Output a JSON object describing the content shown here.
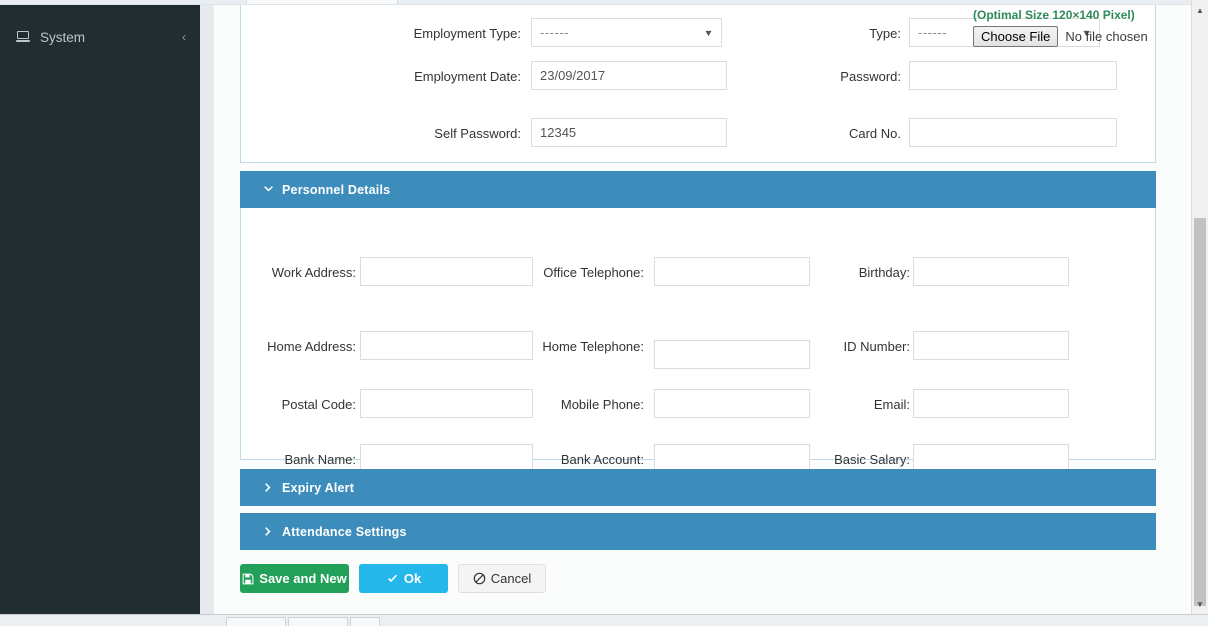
{
  "sidebar": {
    "item": {
      "label": "System",
      "icon": "monitor-icon",
      "collapse_icon": "chevron-left-icon"
    }
  },
  "employment_section": {
    "fields": [
      {
        "label": "Employment Type:",
        "type": "select",
        "value": "------",
        "name": "employment-type"
      },
      {
        "label": "Type:",
        "type": "select",
        "value": "------",
        "name": "type"
      },
      {
        "label": "Employment Date:",
        "type": "text",
        "value": "23/09/2017",
        "name": "employment-date"
      },
      {
        "label": "Password:",
        "type": "text",
        "value": "",
        "name": "password"
      },
      {
        "label": "Self Password:",
        "type": "text",
        "value": "12345",
        "name": "self-password"
      },
      {
        "label": "Card No.",
        "type": "text",
        "value": "",
        "name": "card-no"
      }
    ],
    "upload": {
      "hint": "(Optimal Size 120×140 Pixel)",
      "button_label": "Choose File",
      "status": "No file chosen"
    }
  },
  "personnel_section": {
    "title": "Personnel Details",
    "expanded": true,
    "toggle_icon": "chevron-down-icon",
    "fields": [
      {
        "label": "Work Address:",
        "value": "",
        "name": "work-address"
      },
      {
        "label": "Office Telephone:",
        "value": "",
        "name": "office-telephone"
      },
      {
        "label": "Birthday:",
        "value": "",
        "name": "birthday"
      },
      {
        "label": "Home Address:",
        "value": "",
        "name": "home-address"
      },
      {
        "label": "Home Telephone:",
        "value": "",
        "name": "home-telephone"
      },
      {
        "label": "ID Number:",
        "value": "",
        "name": "id-number"
      },
      {
        "label": "Postal Code:",
        "value": "",
        "name": "postal-code"
      },
      {
        "label": "Mobile Phone:",
        "value": "",
        "name": "mobile-phone"
      },
      {
        "label": "Email:",
        "value": "",
        "name": "email"
      },
      {
        "label": "Bank Name:",
        "value": "",
        "name": "bank-name"
      },
      {
        "label": "Bank Account:",
        "value": "",
        "name": "bank-account"
      },
      {
        "label": "Basic Salary:",
        "value": "",
        "name": "basic-salary"
      }
    ]
  },
  "expiry_section": {
    "title": "Expiry Alert",
    "expanded": false,
    "toggle_icon": "chevron-right-icon"
  },
  "attendance_section": {
    "title": "Attendance Settings",
    "expanded": false,
    "toggle_icon": "chevron-right-icon"
  },
  "footer": {
    "save_and_new": {
      "label": "Save and New",
      "icon": "floppy-disk-icon"
    },
    "ok": {
      "label": "Ok",
      "icon": "check-icon"
    },
    "cancel": {
      "label": "Cancel",
      "icon": "ban-icon"
    }
  },
  "colors": {
    "section_header_blue": "#3c8dbc",
    "sidebar_dark": "#222d32",
    "save_green": "#22a05a",
    "ok_cyan": "#24b7ea",
    "hint_green": "#2f8a5b",
    "card_border_blue": "#bcdae8"
  },
  "scrollbar": {
    "up_icon": "triangle-up-icon",
    "down_icon": "triangle-down-icon"
  }
}
